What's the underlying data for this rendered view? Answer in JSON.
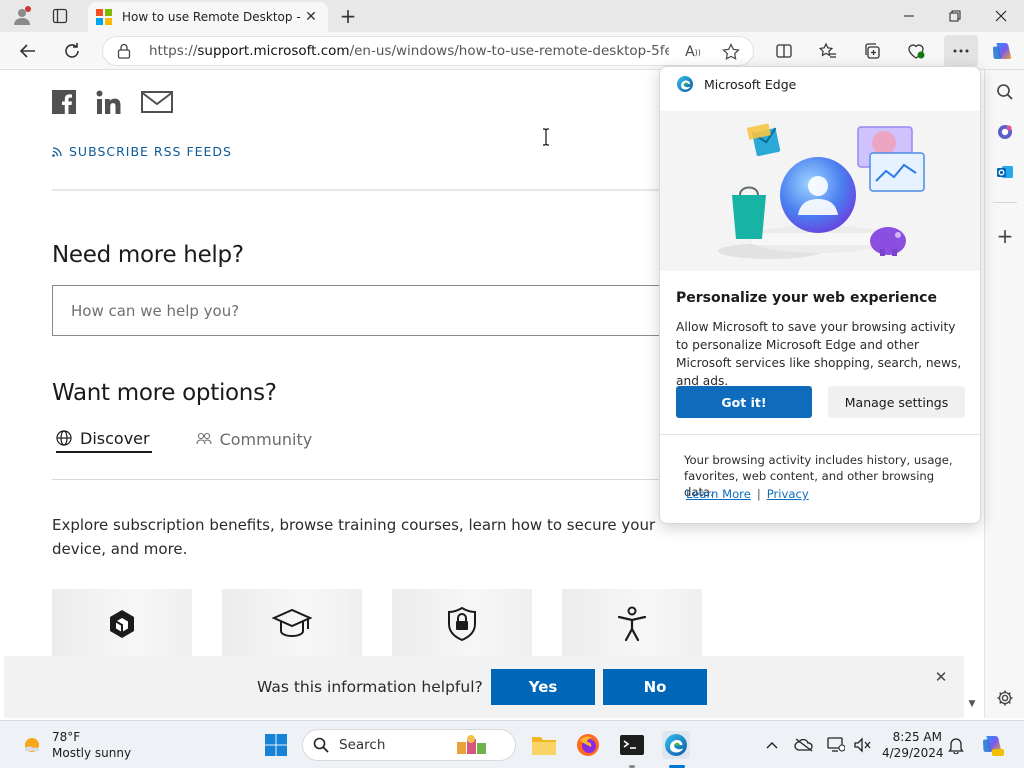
{
  "browser": {
    "tab_title": "How to use Remote Desktop - M",
    "url_prefix": "https://",
    "url_host": "support.microsoft.com",
    "url_path": "/en-us/windows/how-to-use-remote-desktop-5fe12...",
    "accent": "#0f6cbd"
  },
  "page": {
    "rss_label": "SUBSCRIBE RSS FEEDS",
    "need_help_heading": "Need more help?",
    "search_placeholder": "How can we help you?",
    "more_options_heading": "Want more options?",
    "tabs": [
      {
        "label": "Discover",
        "icon": "globe-icon",
        "active": true
      },
      {
        "label": "Community",
        "icon": "people-icon",
        "active": false
      }
    ],
    "explore_text": "Explore subscription benefits, browse training courses, learn how to secure your device, and more.",
    "cards": [
      {
        "icon": "microsoft365-icon"
      },
      {
        "icon": "graduation-cap-icon"
      },
      {
        "icon": "shield-lock-icon"
      },
      {
        "icon": "accessibility-icon"
      }
    ]
  },
  "feedback": {
    "question": "Was this information helpful?",
    "yes_label": "Yes",
    "no_label": "No",
    "button_color": "#0067b8"
  },
  "popup": {
    "brand": "Microsoft Edge",
    "title": "Personalize your web experience",
    "body": "Allow Microsoft to save your browsing activity to personalize Microsoft Edge and other Microsoft services like shopping, search, news, and ads.",
    "primary_label": "Got it!",
    "secondary_label": "Manage settings",
    "footer": "Your browsing activity includes history, usage, favorites, web content, and other browsing data.",
    "learn_more": "Learn More",
    "link_separator": "|",
    "privacy": "Privacy"
  },
  "taskbar": {
    "temperature": "78°F",
    "weather_desc": "Mostly sunny",
    "search_label": "Search",
    "time": "8:25 AM",
    "date": "4/29/2024"
  }
}
